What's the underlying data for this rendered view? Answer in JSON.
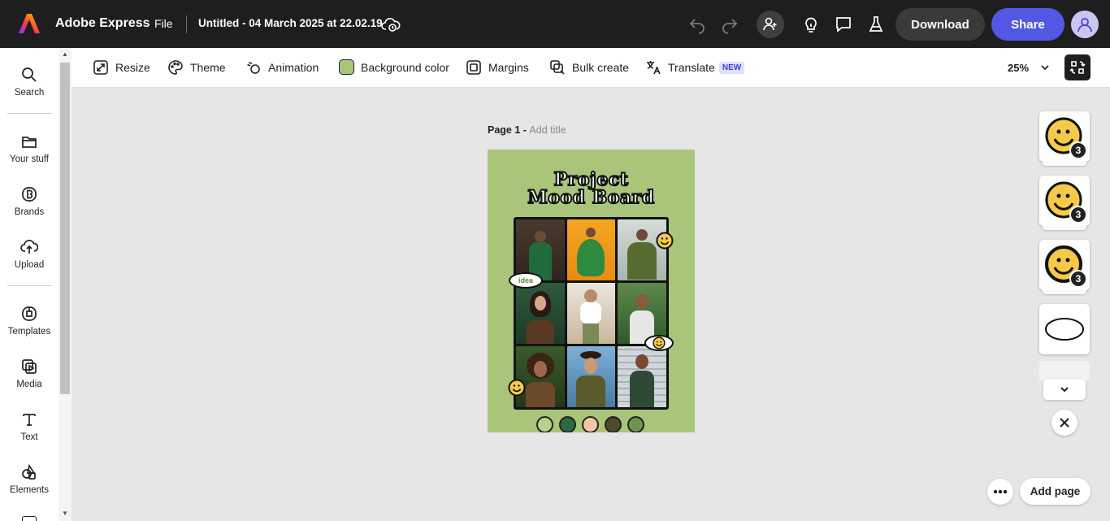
{
  "header": {
    "app_name": "Adobe Express",
    "file_menu": "File",
    "doc_title": "Untitled - 04 March 2025 at 22.02.19",
    "download_label": "Download",
    "share_label": "Share"
  },
  "sidebar": {
    "items": [
      {
        "label": "Search",
        "icon": "search-icon"
      },
      {
        "label": "Your stuff",
        "icon": "folder-icon"
      },
      {
        "label": "Brands",
        "icon": "brand-icon"
      },
      {
        "label": "Upload",
        "icon": "upload-icon"
      },
      {
        "label": "Templates",
        "icon": "templates-icon"
      },
      {
        "label": "Media",
        "icon": "media-icon"
      },
      {
        "label": "Text",
        "icon": "text-icon"
      },
      {
        "label": "Elements",
        "icon": "elements-icon"
      }
    ]
  },
  "toolbar": {
    "resize": "Resize",
    "theme": "Theme",
    "animation": "Animation",
    "background_color": "Background color",
    "margins": "Margins",
    "bulk_create": "Bulk create",
    "translate": "Translate",
    "new_badge": "NEW",
    "zoom": "25%"
  },
  "canvas": {
    "page_label": "Page 1 - ",
    "add_title": "Add title",
    "art_title_line1": "Project",
    "art_title_line2": "Mood Board",
    "idea_sticker": "idea",
    "swatch_colors": [
      "#b4d48a",
      "#2e6a45",
      "#f5c6a5",
      "#4f4a2e",
      "#6e9450"
    ],
    "accent_bg": "#a9c57a"
  },
  "right_panel": {
    "badge_count": "3",
    "add_page": "Add page"
  },
  "colors": {
    "topbar": "#1e1e1e",
    "share": "#5258e4",
    "download": "#3a3a3a"
  }
}
